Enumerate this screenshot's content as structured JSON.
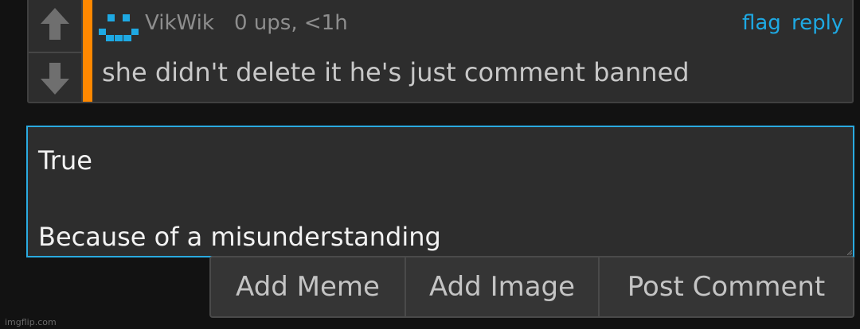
{
  "comment": {
    "username": "VikWik",
    "meta": "0 ups, <1h",
    "flag_label": "flag",
    "reply_label": "reply",
    "text": "she didn't delete it he's just comment banned"
  },
  "reply_box": {
    "value": "True\n\nBecause of a misunderstanding"
  },
  "buttons": {
    "add_meme": "Add Meme",
    "add_image": "Add Image",
    "post_comment": "Post Comment"
  },
  "watermark": "imgflip.com",
  "colors": {
    "background": "#121212",
    "card": "#2d2d2d",
    "accent_bar": "#ff8800",
    "link": "#1ea9e3",
    "input_border": "#2aaae0",
    "avatar": "#1ea9e3"
  },
  "icons": {
    "upvote": "arrow-up-icon",
    "downvote": "arrow-down-icon",
    "avatar": "pixel-face-avatar-icon"
  }
}
